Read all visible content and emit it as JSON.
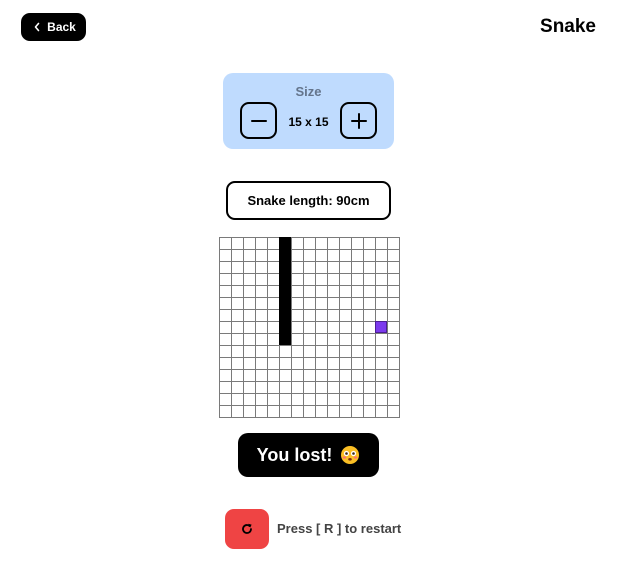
{
  "header": {
    "back_label": "Back",
    "title": "Snake"
  },
  "size_panel": {
    "label": "Size",
    "value": "15 x 15",
    "decrease_icon": "minus-icon",
    "increase_icon": "plus-icon"
  },
  "status": {
    "length_text": "Snake length: 90cm",
    "lost_text": "You lost!",
    "lost_emoji": "flushed-face-icon"
  },
  "board": {
    "columns": 15,
    "rows": 15,
    "snake_cells": [
      [
        5,
        0
      ],
      [
        5,
        1
      ],
      [
        5,
        2
      ],
      [
        5,
        3
      ],
      [
        5,
        4
      ],
      [
        5,
        5
      ],
      [
        5,
        6
      ],
      [
        5,
        7
      ],
      [
        5,
        8
      ]
    ],
    "food_cell": [
      13,
      7
    ],
    "colors": {
      "snake": "#000000",
      "food": "#7c3aed",
      "grid": "#7a7a7a"
    }
  },
  "restart": {
    "icon": "restart-icon",
    "hint": "Press [ R ] to restart"
  },
  "colors": {
    "size_panel_bg": "#bfdbfe",
    "restart_bg": "#ef4444"
  }
}
